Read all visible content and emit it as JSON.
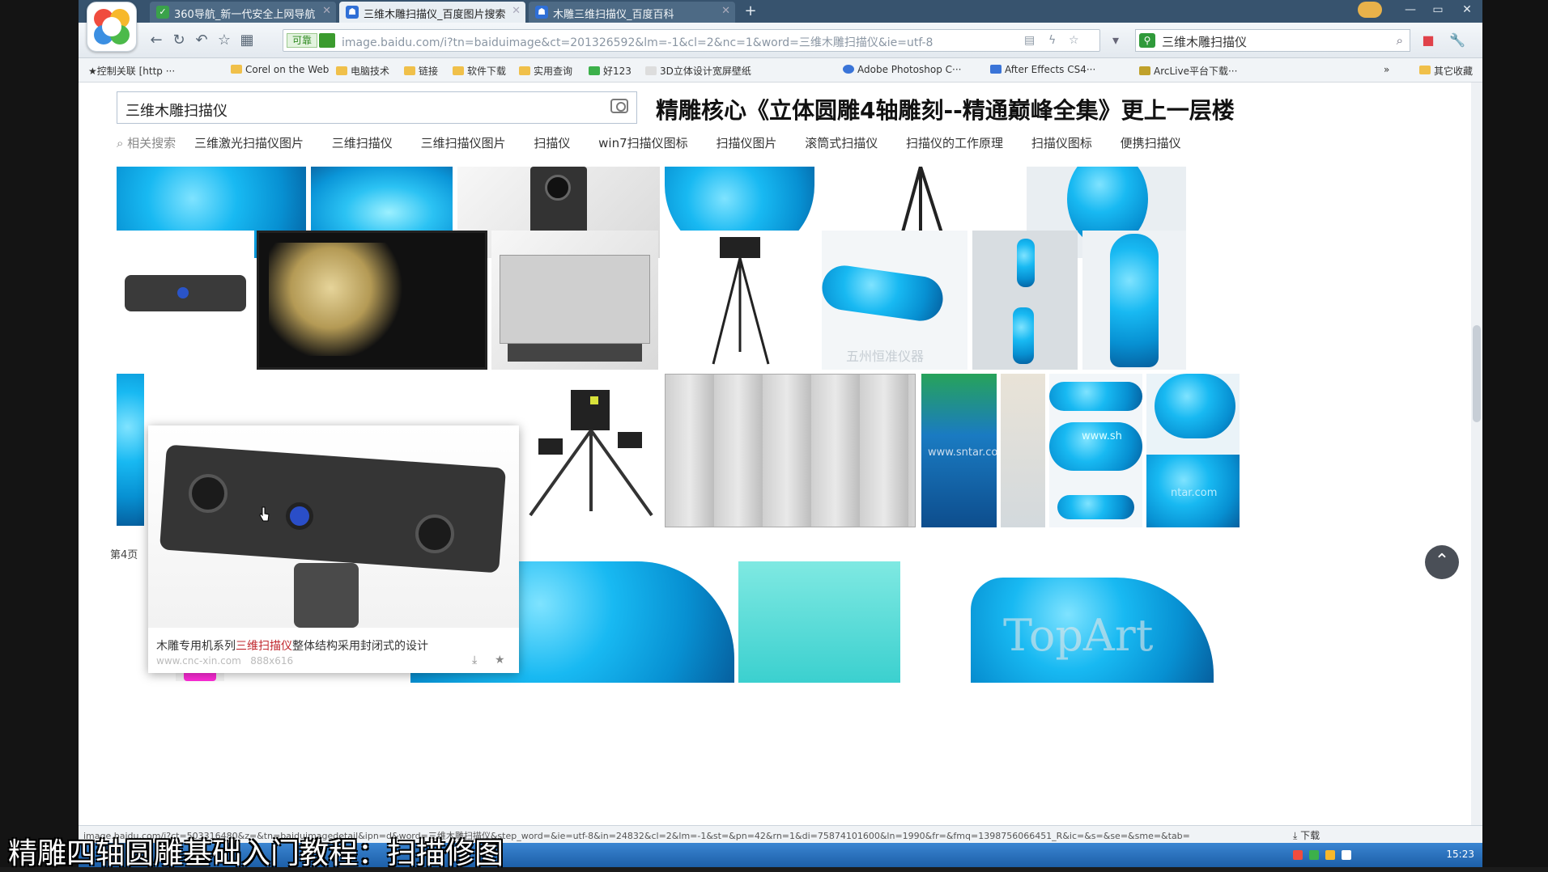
{
  "browser": {
    "tabs": [
      {
        "label": "360导航_新一代安全上网导航"
      },
      {
        "label": "三维木雕扫描仪_百度图片搜索"
      },
      {
        "label": "木雕三维扫描仪_百度百科"
      }
    ],
    "new_tab": "+",
    "window_controls": [
      "—",
      "▭",
      "✕"
    ],
    "address": {
      "trust_label": "可靠",
      "url": "image.baidu.com/i?tn=baiduimage&ct=201326592&lm=-1&cl=2&nc=1&word=三维木雕扫描仪&ie=utf-8"
    },
    "search": {
      "text": "三维木雕扫描仪"
    },
    "bookmarks": [
      {
        "label": "★控制关联 [http ···"
      },
      {
        "label": "Corel on the Web"
      },
      {
        "label": "电脑技术"
      },
      {
        "label": "链接"
      },
      {
        "label": "软件下载"
      },
      {
        "label": "实用查询"
      },
      {
        "label": "好123"
      },
      {
        "label": "3D立体设计宽屏壁纸"
      },
      {
        "label": "Adobe Photoshop C···"
      },
      {
        "label": "After Effects CS4···"
      },
      {
        "label": "ArcLive平台下载···"
      }
    ],
    "bookmarks_more": "»",
    "bookmarks_end": "其它收藏"
  },
  "page": {
    "query": "三维木雕扫描仪",
    "banner": "精雕核心《立体圆雕4轴雕刻--精通巅峰全集》更上一层楼",
    "related_label": "相关搜索",
    "related": [
      "三维激光扫描仪图片",
      "三维扫描仪",
      "三维扫描仪图片",
      "扫描仪",
      "win7扫描仪图标",
      "扫描仪图片",
      "滚筒式扫描仪",
      "扫描仪的工作原理",
      "扫描仪图标",
      "便携扫描仪"
    ],
    "page_label": "第4页",
    "popup": {
      "caption_pre": "木雕专用机系列",
      "caption_hl": "三维扫描仪",
      "caption_post": "整体结构采用封闭式的设计",
      "source": "www.cnc-xin.com",
      "size": "888x616"
    },
    "watermarks": [
      "五州恒准仪器",
      "www.sntar.com",
      "www.sh",
      "ntar.com",
      "TopArt"
    ]
  },
  "status": {
    "url": "image.baidu.com/i?ct=503316480&z=&tn=baiduimagedetail&ipn=d&word=三维木雕扫描仪&step_word=&ie=utf-8&in=24832&cl=2&lm=-1&st=&pn=42&rn=1&di=75874101600&ln=1990&fr=&fmq=1398756066451_R&ic=&s=&se=&sme=&tab=",
    "download": "下载",
    "clock": "15:23"
  },
  "subtitle": "精雕四轴圆雕基础入门教程：扫描修图",
  "colors": {
    "tabbar": "#37536e",
    "accent": "#c0262c",
    "taskbar": "#1d5fa8"
  }
}
